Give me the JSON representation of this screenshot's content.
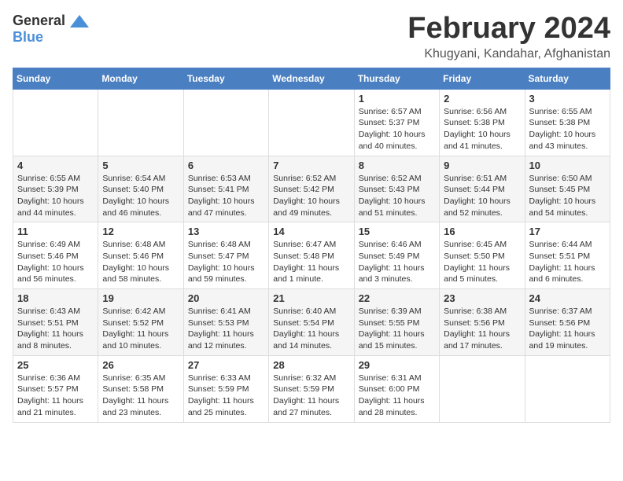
{
  "logo": {
    "general": "General",
    "blue": "Blue"
  },
  "title": {
    "month": "February 2024",
    "location": "Khugyani, Kandahar, Afghanistan"
  },
  "weekdays": [
    "Sunday",
    "Monday",
    "Tuesday",
    "Wednesday",
    "Thursday",
    "Friday",
    "Saturday"
  ],
  "weeks": [
    [
      {
        "day": "",
        "info": ""
      },
      {
        "day": "",
        "info": ""
      },
      {
        "day": "",
        "info": ""
      },
      {
        "day": "",
        "info": ""
      },
      {
        "day": "1",
        "info": "Sunrise: 6:57 AM\nSunset: 5:37 PM\nDaylight: 10 hours\nand 40 minutes."
      },
      {
        "day": "2",
        "info": "Sunrise: 6:56 AM\nSunset: 5:38 PM\nDaylight: 10 hours\nand 41 minutes."
      },
      {
        "day": "3",
        "info": "Sunrise: 6:55 AM\nSunset: 5:38 PM\nDaylight: 10 hours\nand 43 minutes."
      }
    ],
    [
      {
        "day": "4",
        "info": "Sunrise: 6:55 AM\nSunset: 5:39 PM\nDaylight: 10 hours\nand 44 minutes."
      },
      {
        "day": "5",
        "info": "Sunrise: 6:54 AM\nSunset: 5:40 PM\nDaylight: 10 hours\nand 46 minutes."
      },
      {
        "day": "6",
        "info": "Sunrise: 6:53 AM\nSunset: 5:41 PM\nDaylight: 10 hours\nand 47 minutes."
      },
      {
        "day": "7",
        "info": "Sunrise: 6:52 AM\nSunset: 5:42 PM\nDaylight: 10 hours\nand 49 minutes."
      },
      {
        "day": "8",
        "info": "Sunrise: 6:52 AM\nSunset: 5:43 PM\nDaylight: 10 hours\nand 51 minutes."
      },
      {
        "day": "9",
        "info": "Sunrise: 6:51 AM\nSunset: 5:44 PM\nDaylight: 10 hours\nand 52 minutes."
      },
      {
        "day": "10",
        "info": "Sunrise: 6:50 AM\nSunset: 5:45 PM\nDaylight: 10 hours\nand 54 minutes."
      }
    ],
    [
      {
        "day": "11",
        "info": "Sunrise: 6:49 AM\nSunset: 5:46 PM\nDaylight: 10 hours\nand 56 minutes."
      },
      {
        "day": "12",
        "info": "Sunrise: 6:48 AM\nSunset: 5:46 PM\nDaylight: 10 hours\nand 58 minutes."
      },
      {
        "day": "13",
        "info": "Sunrise: 6:48 AM\nSunset: 5:47 PM\nDaylight: 10 hours\nand 59 minutes."
      },
      {
        "day": "14",
        "info": "Sunrise: 6:47 AM\nSunset: 5:48 PM\nDaylight: 11 hours\nand 1 minute."
      },
      {
        "day": "15",
        "info": "Sunrise: 6:46 AM\nSunset: 5:49 PM\nDaylight: 11 hours\nand 3 minutes."
      },
      {
        "day": "16",
        "info": "Sunrise: 6:45 AM\nSunset: 5:50 PM\nDaylight: 11 hours\nand 5 minutes."
      },
      {
        "day": "17",
        "info": "Sunrise: 6:44 AM\nSunset: 5:51 PM\nDaylight: 11 hours\nand 6 minutes."
      }
    ],
    [
      {
        "day": "18",
        "info": "Sunrise: 6:43 AM\nSunset: 5:51 PM\nDaylight: 11 hours\nand 8 minutes."
      },
      {
        "day": "19",
        "info": "Sunrise: 6:42 AM\nSunset: 5:52 PM\nDaylight: 11 hours\nand 10 minutes."
      },
      {
        "day": "20",
        "info": "Sunrise: 6:41 AM\nSunset: 5:53 PM\nDaylight: 11 hours\nand 12 minutes."
      },
      {
        "day": "21",
        "info": "Sunrise: 6:40 AM\nSunset: 5:54 PM\nDaylight: 11 hours\nand 14 minutes."
      },
      {
        "day": "22",
        "info": "Sunrise: 6:39 AM\nSunset: 5:55 PM\nDaylight: 11 hours\nand 15 minutes."
      },
      {
        "day": "23",
        "info": "Sunrise: 6:38 AM\nSunset: 5:56 PM\nDaylight: 11 hours\nand 17 minutes."
      },
      {
        "day": "24",
        "info": "Sunrise: 6:37 AM\nSunset: 5:56 PM\nDaylight: 11 hours\nand 19 minutes."
      }
    ],
    [
      {
        "day": "25",
        "info": "Sunrise: 6:36 AM\nSunset: 5:57 PM\nDaylight: 11 hours\nand 21 minutes."
      },
      {
        "day": "26",
        "info": "Sunrise: 6:35 AM\nSunset: 5:58 PM\nDaylight: 11 hours\nand 23 minutes."
      },
      {
        "day": "27",
        "info": "Sunrise: 6:33 AM\nSunset: 5:59 PM\nDaylight: 11 hours\nand 25 minutes."
      },
      {
        "day": "28",
        "info": "Sunrise: 6:32 AM\nSunset: 5:59 PM\nDaylight: 11 hours\nand 27 minutes."
      },
      {
        "day": "29",
        "info": "Sunrise: 6:31 AM\nSunset: 6:00 PM\nDaylight: 11 hours\nand 28 minutes."
      },
      {
        "day": "",
        "info": ""
      },
      {
        "day": "",
        "info": ""
      }
    ]
  ]
}
